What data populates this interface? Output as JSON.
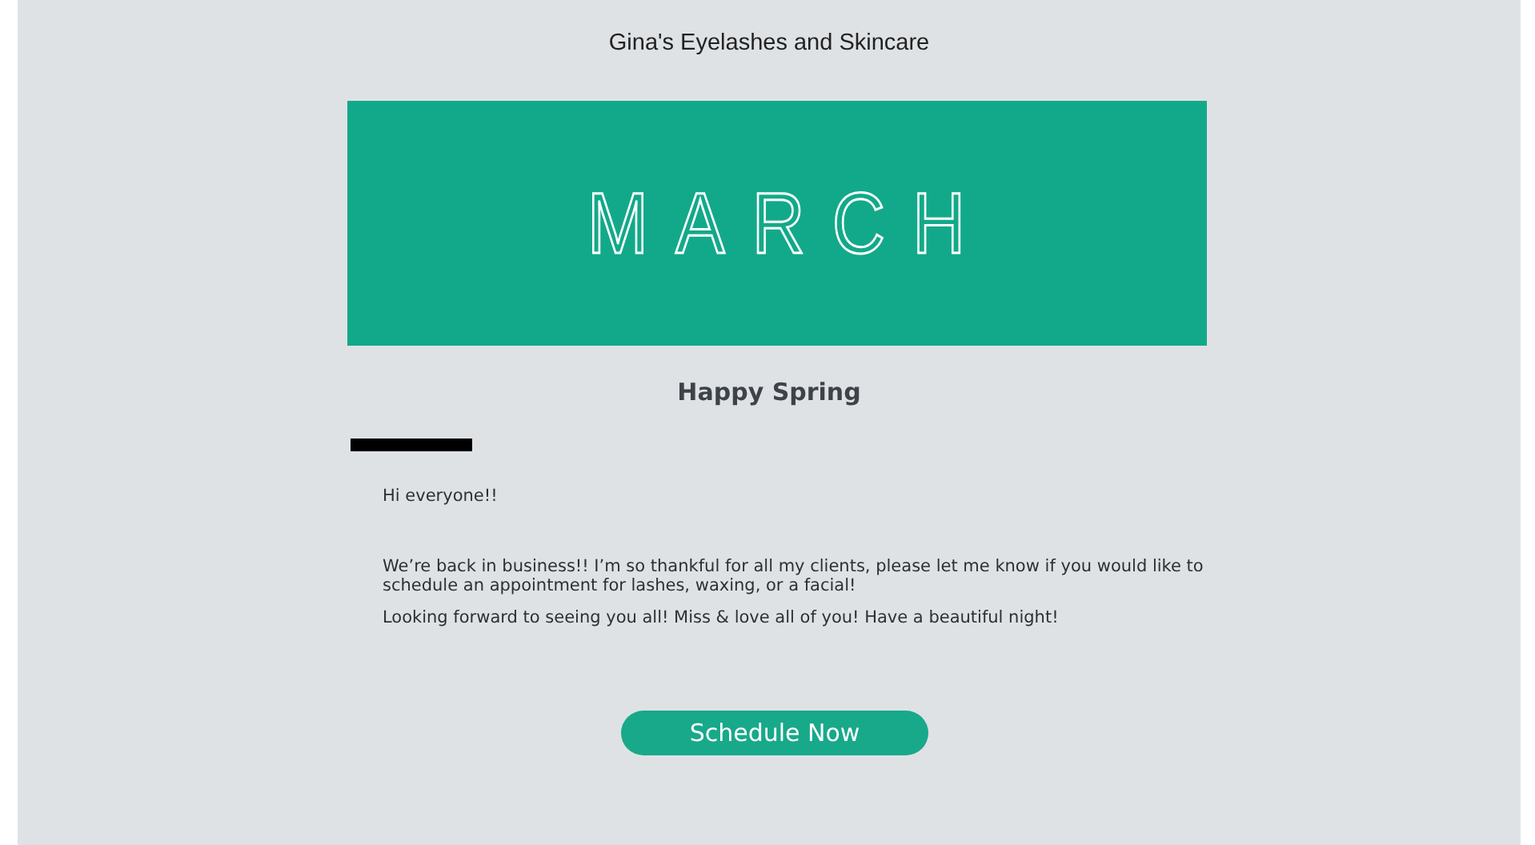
{
  "header": {
    "business_name": "Gina's Eyelashes and Skincare"
  },
  "banner": {
    "text": "MARCH"
  },
  "heading": "Happy Spring",
  "paragraphs": [
    "Hi everyone!!",
    "We’re back in business!! I’m so thankful for all my clients, please let me know if you would like to schedule an appointment for lashes, waxing, or a facial!",
    "Looking forward to seeing you all! Miss & love all of you! Have a beautiful night!"
  ],
  "button": {
    "label": "Schedule Now"
  }
}
